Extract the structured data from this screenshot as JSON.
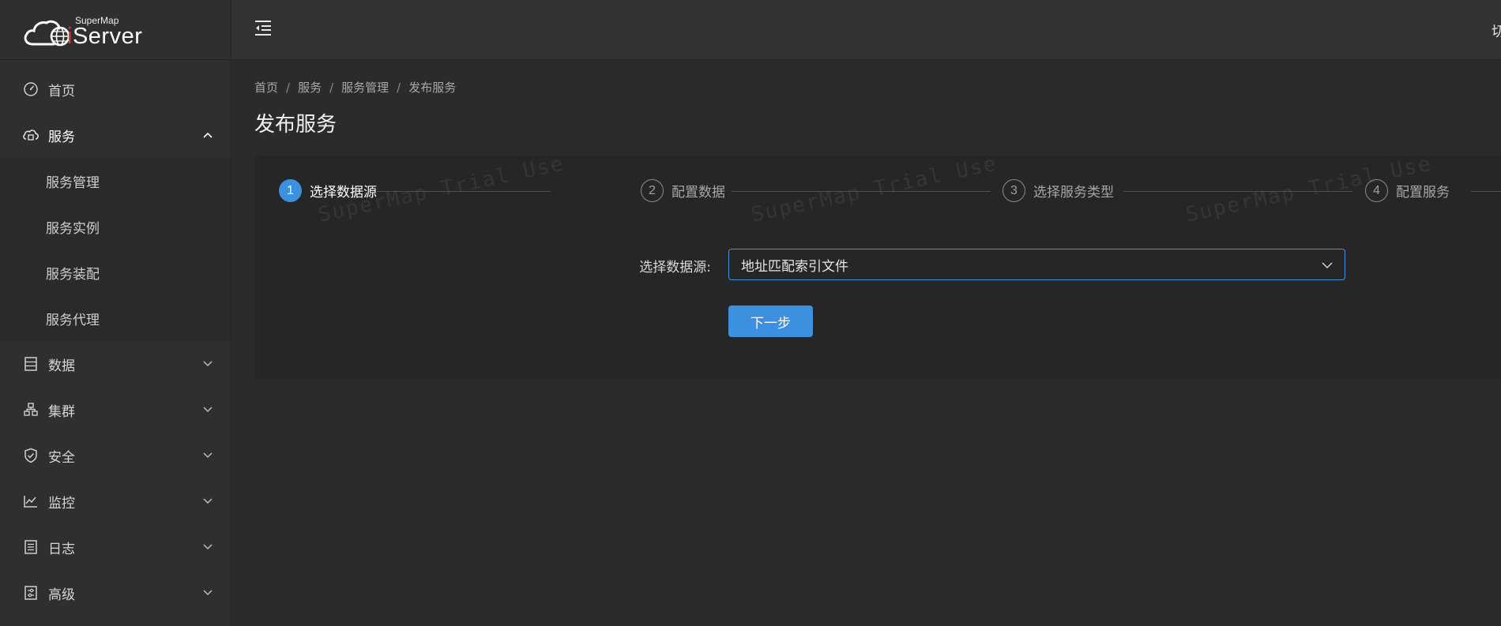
{
  "brand": {
    "company": "SuperMap",
    "product_prefix": "i",
    "product_name": "Server",
    "logo_icon": "cloud-globe-icon"
  },
  "header": {
    "collapse_icon": "menu-fold-icon",
    "right_text": "切"
  },
  "sidebar": {
    "items": [
      {
        "label": "首页",
        "icon": "dashboard-icon"
      },
      {
        "label": "服务",
        "icon": "cloud-service-icon",
        "expanded": true,
        "children": [
          {
            "label": "服务管理"
          },
          {
            "label": "服务实例"
          },
          {
            "label": "服务装配"
          },
          {
            "label": "服务代理"
          }
        ]
      },
      {
        "label": "数据",
        "icon": "database-icon"
      },
      {
        "label": "集群",
        "icon": "cluster-icon"
      },
      {
        "label": "安全",
        "icon": "shield-icon"
      },
      {
        "label": "监控",
        "icon": "line-chart-icon"
      },
      {
        "label": "日志",
        "icon": "log-icon"
      },
      {
        "label": "高级",
        "icon": "advanced-icon"
      }
    ]
  },
  "breadcrumb": [
    "首页",
    "服务",
    "服务管理",
    "发布服务"
  ],
  "page": {
    "title": "发布服务"
  },
  "watermark": "SuperMap Trial Use",
  "steps": [
    {
      "number": "1",
      "label": "选择数据源",
      "active": true
    },
    {
      "number": "2",
      "label": "配置数据",
      "active": false
    },
    {
      "number": "3",
      "label": "选择服务类型",
      "active": false
    },
    {
      "number": "4",
      "label": "配置服务",
      "active": false
    }
  ],
  "form": {
    "datasource_label": "选择数据源:",
    "datasource_value": "地址匹配索引文件",
    "next_button": "下一步"
  },
  "colors": {
    "accent": "#3d8fe0",
    "background": "#2b2b2b",
    "sidebar": "#2f2f2f",
    "card": "#262626"
  }
}
